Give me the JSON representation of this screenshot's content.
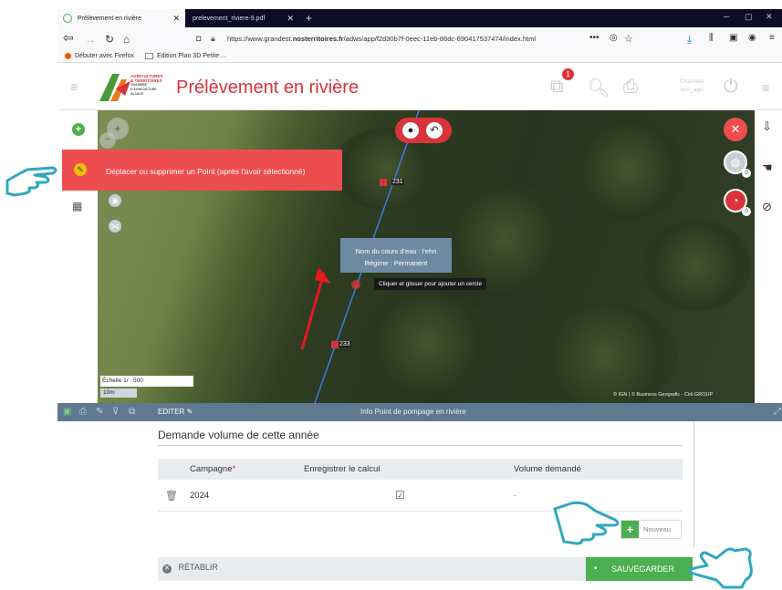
{
  "browser": {
    "tabs": [
      {
        "label": "Prélèvement en rivière",
        "active": true
      },
      {
        "label": "prelevement_riviere-9.pdf",
        "active": false
      }
    ],
    "url_prefix": "https://www.grandest.",
    "url_domain": "nosterritoires.fr",
    "url_path": "/adws/app/f2d30b7f-0eec-11eb-86dc-690417537474/index.html",
    "bookmarks": [
      "Débuter avec Firefox",
      "Edition Plan 3D Petite ..."
    ]
  },
  "app": {
    "logo_lines": [
      "AGRICULTURES",
      "& TERRITOIRES",
      "CHAMBRE D'AGRICULTURE",
      "ALSACE"
    ],
    "title": "Prélèvement en rivière",
    "notification_count": "1",
    "user_line1": "Chambre",
    "user_line2": "test_agri"
  },
  "map": {
    "banner": "Déplacer ou supprimer un Point (après l'avoir sélectionné)",
    "popup_line1": "Nom du cours d'eau : l'ehn",
    "popup_line2": "Régime : Permanent",
    "tooltip": "Cliquer et glisser pour ajouter un cercle",
    "marker_labels": [
      "231",
      "233"
    ],
    "scale_label": "Échelle 1/",
    "scale_value": "500",
    "scale_meter": "10m",
    "attribution": "© IGN | © Business Geografic - Ciril GROUP",
    "tool_badges": [
      "0",
      "0"
    ]
  },
  "panel": {
    "edit_label": "EDITER",
    "title": "Info Point de pompage en rivière"
  },
  "form": {
    "section_title": "Demande volume de cette année",
    "columns": {
      "campagne": "Campagne",
      "required_mark": "*",
      "enregistrer": "Enregistrer le calcul",
      "volume": "Volume demandé"
    },
    "row": {
      "campagne": "2024",
      "checked": "☑",
      "volume": "-"
    },
    "new_button": "Nouveau",
    "reset_button": "RÉTABLIR",
    "save_button": "SAUVEGARDER"
  },
  "colors": {
    "brand_red": "#d9343b",
    "banner_red": "#ee4d4f",
    "panel_blue": "#5f7990",
    "save_green": "#4caf50",
    "hand_outline": "#2fa7bf",
    "arrow_red": "#e8181e"
  }
}
